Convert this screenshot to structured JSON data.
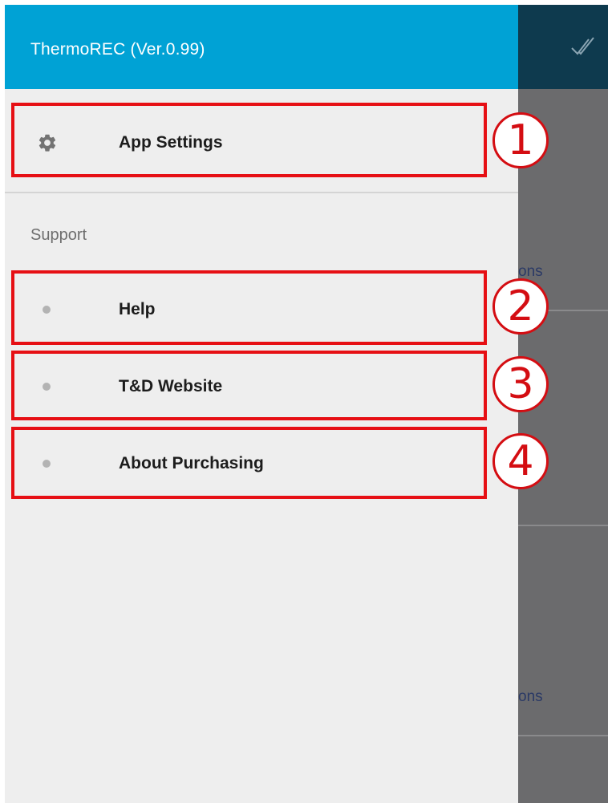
{
  "drawer": {
    "title": "ThermoREC (Ver.0.99)",
    "settings_label": "App Settings",
    "section_header": "Support",
    "support_items": [
      {
        "label": "Help"
      },
      {
        "label": "T&D Website"
      },
      {
        "label": "About Purchasing"
      }
    ]
  },
  "background": {
    "partial_text_1": "ons",
    "partial_text_2": "ons"
  },
  "annotations": [
    "1",
    "2",
    "3",
    "4"
  ],
  "colors": {
    "header": "#00a2d5",
    "drawer_bg": "#eeeeee",
    "annotation": "#e60f14"
  },
  "icons": {
    "settings": "gear-icon",
    "support_item": "dot-icon",
    "background_action": "double-check-icon"
  }
}
